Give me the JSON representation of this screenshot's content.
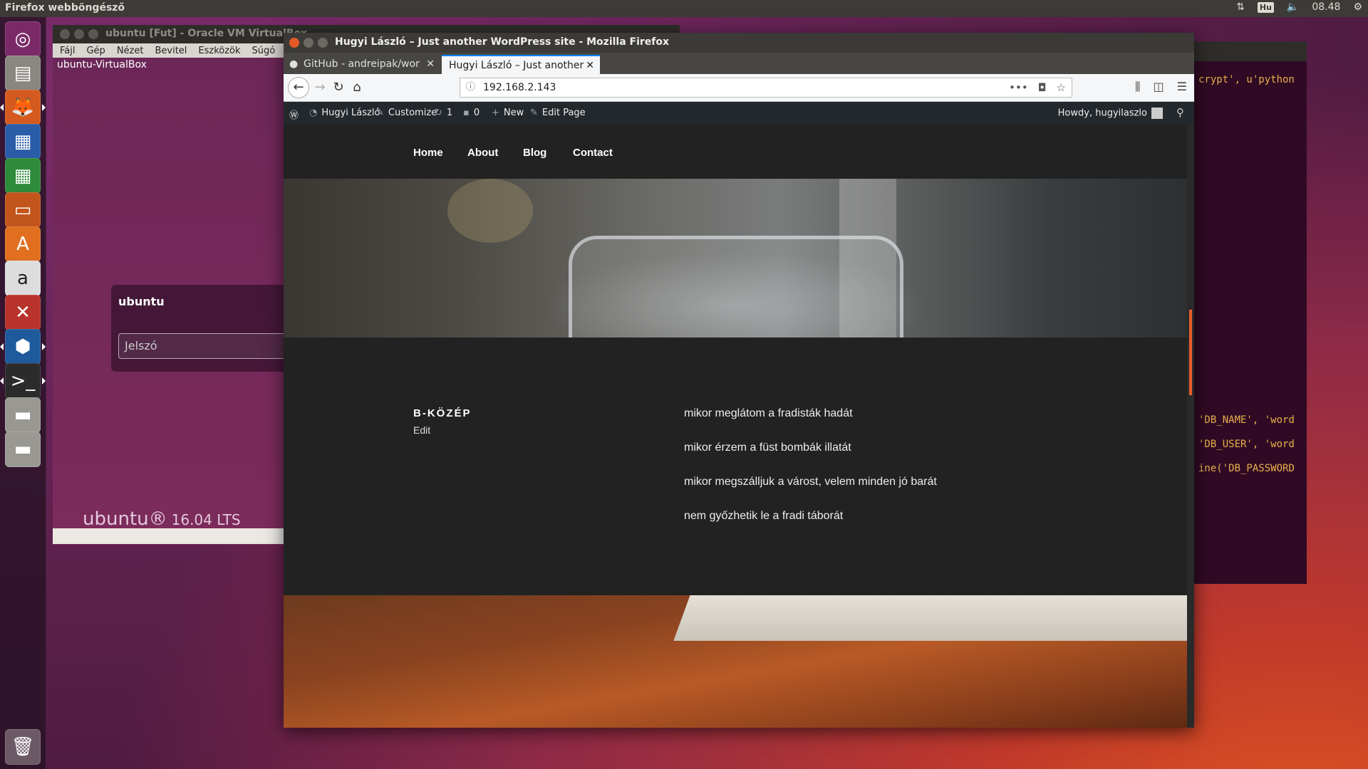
{
  "top_panel": {
    "app_title": "Firefox webböngésző",
    "keyboard": "Hu",
    "time": "08.48"
  },
  "launcher": {
    "items": [
      "ubuntu-dash",
      "files",
      "firefox",
      "writer",
      "calc",
      "impress",
      "software-center",
      "amazon",
      "system-settings",
      "virtualbox",
      "terminal",
      "drive",
      "drive",
      "trash"
    ]
  },
  "vbox": {
    "title": "ubuntu [Fut] - Oracle VM VirtualBox",
    "menu": [
      "Fájl",
      "Gép",
      "Nézet",
      "Bevitel",
      "Eszközök",
      "Súgó"
    ],
    "hostname": "ubuntu-VirtualBox",
    "login_user": "ubuntu",
    "password_placeholder": "Jelszó",
    "brand": "ubuntu®",
    "version": "16.04 LTS"
  },
  "terminal": {
    "lines": [
      "crypt', u'python",
      "'DB_NAME', 'word",
      "'DB_USER', 'word",
      "ine('DB_PASSWORD"
    ]
  },
  "firefox": {
    "window_title": "Hugyi László – Just another WordPress site - Mozilla Firefox",
    "tabs": [
      {
        "label": "GitHub - andreipak/wor",
        "active": false
      },
      {
        "label": "Hugyi László – Just another",
        "active": true
      }
    ],
    "url": "192.168.2.143"
  },
  "wp_admin_bar": {
    "site_name": "Hugyi László",
    "customize": "Customize",
    "updates_count": "1",
    "comments_count": "0",
    "new": "New",
    "edit_page": "Edit Page",
    "howdy": "Howdy, hugyilaszlo"
  },
  "site": {
    "nav": [
      "Home",
      "About",
      "Blog",
      "Contact"
    ],
    "entry_title": "B-KÖZÉP",
    "edit_label": "Edit",
    "verses": [
      "mikor meglátom a fradisták hadát",
      "mikor érzem a füst bombák illatát",
      "mikor megszálljuk a várost, velem minden jó barát",
      "nem győzhetik le a fradi táborát"
    ]
  },
  "colors": {
    "accent": "#e25a27",
    "tab_highlight": "#0a84ff",
    "wp_admin": "#23282d",
    "site_bg": "#222222"
  }
}
